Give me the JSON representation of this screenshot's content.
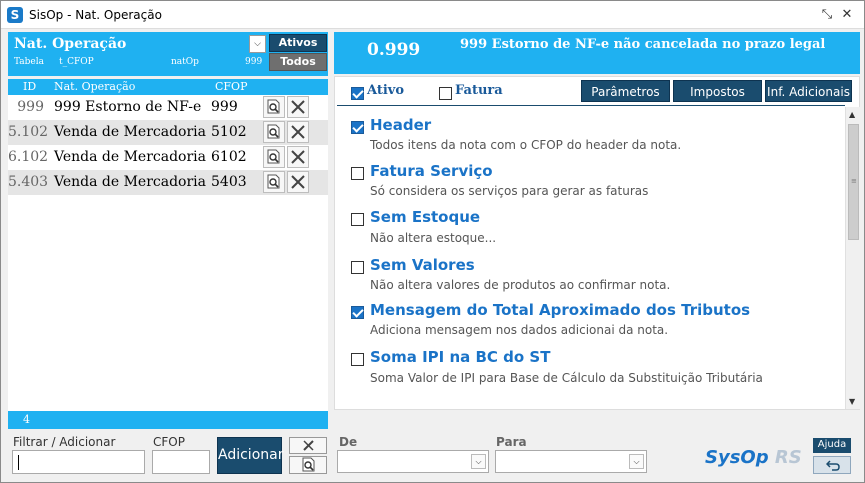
{
  "window": {
    "title": "SisOp - Nat. Operação",
    "icon_letter": "S"
  },
  "left": {
    "title": "Nat. Operação",
    "table_label": "Tabela",
    "table_value": "t_CFOP",
    "field_label": "natOp",
    "field_count": "999",
    "btn_ativos": "Ativos",
    "btn_todos": "Todos",
    "columns": {
      "id": "ID",
      "name": "Nat. Operação",
      "cfop": "CFOP"
    },
    "rows": [
      {
        "id": "999",
        "name": "999 Estorno de NF-e",
        "cfop": "999"
      },
      {
        "id": "5.102",
        "name": "Venda de Mercadoria",
        "cfop": "5102"
      },
      {
        "id": "6.102",
        "name": "Venda de Mercadoria",
        "cfop": "6102"
      },
      {
        "id": "5.403",
        "name": "Venda de Mercadoria",
        "cfop": "5403"
      }
    ],
    "count": "4"
  },
  "right": {
    "code": "0.999",
    "description": "999 Estorno de NF-e não cancelada no prazo legal",
    "ativo_label": "Ativo",
    "ativo_checked": true,
    "fatura_label": "Fatura",
    "fatura_checked": false,
    "tabs": [
      "Parâmetros",
      "Impostos",
      "Inf. Adicionais"
    ],
    "options": [
      {
        "title": "Header",
        "desc": "Todos itens da nota com o CFOP do header da nota.",
        "checked": true
      },
      {
        "title": "Fatura Serviço",
        "desc": "Só considera os serviços para gerar as faturas",
        "checked": false
      },
      {
        "title": "Sem Estoque",
        "desc": "Não altera estoque...",
        "checked": false
      },
      {
        "title": "Sem Valores",
        "desc": "Não altera valores de produtos ao confirmar nota.",
        "checked": false
      },
      {
        "title": "Mensagem do Total Aproximado dos Tributos",
        "desc": "Adiciona mensagem nos dados adicionai da nota.",
        "checked": true
      },
      {
        "title": "Soma IPI na BC do ST",
        "desc": "Soma Valor de IPI para Base de Cálculo da Substituição Tributária",
        "checked": false
      }
    ]
  },
  "bottom": {
    "filter_label": "Filtrar / Adicionar",
    "filter_value": "",
    "cfop_label": "CFOP",
    "cfop_value": "",
    "add_button": "Adicionar",
    "de_label": "De",
    "para_label": "Para",
    "brand": "SysOp",
    "brand_suffix": "RS",
    "help_button": "Ajuda"
  },
  "colors": {
    "accent_blue": "#1fb1f1",
    "dark_navy": "#1a4c6e",
    "option_title": "#1a73c7"
  }
}
